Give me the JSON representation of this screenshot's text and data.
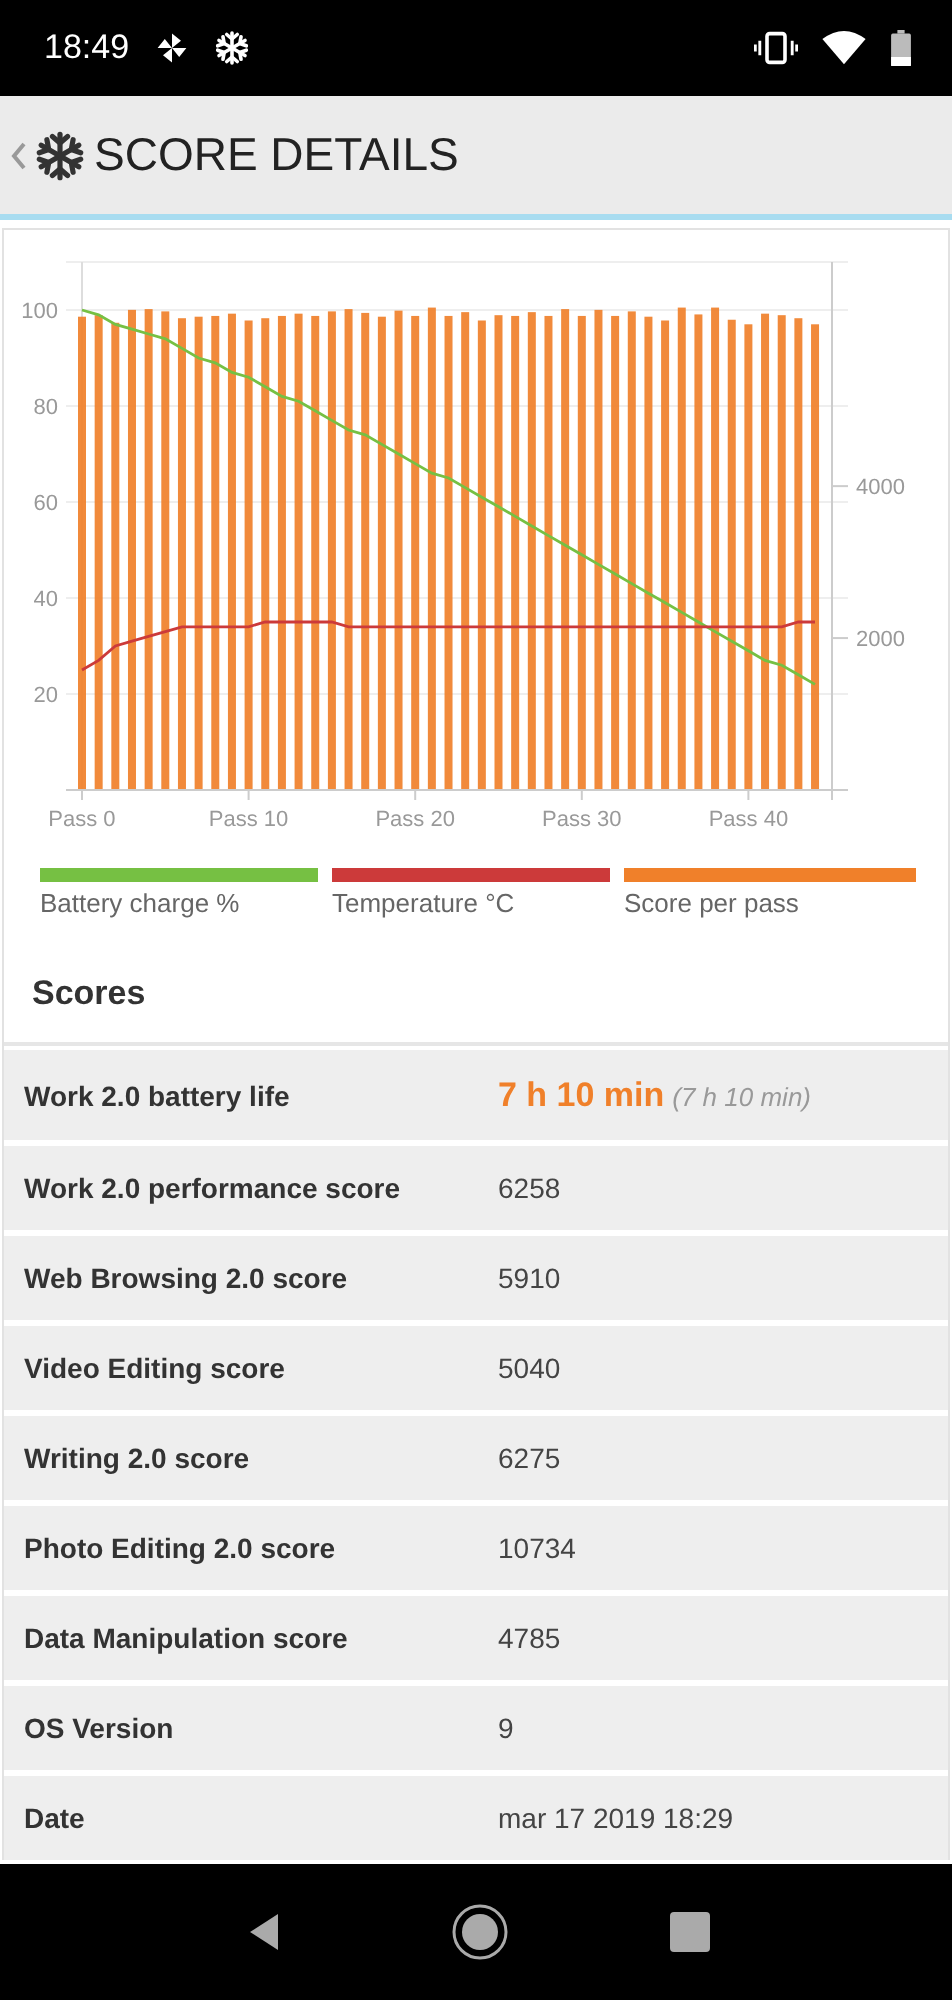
{
  "status_bar": {
    "time": "18:49"
  },
  "header": {
    "title": "SCORE DETAILS"
  },
  "chart_data": {
    "type": "bar",
    "categories": [
      "Pass 0",
      null,
      null,
      null,
      null,
      null,
      null,
      null,
      null,
      null,
      "Pass 10",
      null,
      null,
      null,
      null,
      null,
      null,
      null,
      null,
      null,
      "Pass 20",
      null,
      null,
      null,
      null,
      null,
      null,
      null,
      null,
      null,
      "Pass 30",
      null,
      null,
      null,
      null,
      null,
      null,
      null,
      null,
      null,
      "Pass 40",
      null,
      null,
      null,
      null
    ],
    "grid": true,
    "ylim": [
      0,
      110
    ],
    "yticks": [
      20,
      40,
      60,
      80,
      100
    ],
    "y2lim": [
      0,
      6950
    ],
    "y2ticks": [
      2000,
      4000
    ],
    "series": [
      {
        "name": "Battery charge %",
        "color": "#76c043",
        "type": "line",
        "values": [
          100,
          99,
          97,
          96,
          95,
          94,
          92,
          90,
          89,
          87,
          86,
          84,
          82,
          81,
          79,
          77,
          75,
          74,
          72,
          70,
          68,
          66,
          65,
          63,
          61,
          59,
          57,
          55,
          53,
          51,
          49,
          47,
          45,
          43,
          41,
          39,
          37,
          35,
          33,
          31,
          29,
          27,
          26,
          24,
          22
        ]
      },
      {
        "name": "Temperature °C",
        "color": "#cc3a3a",
        "type": "line",
        "values": [
          25,
          27,
          30,
          31,
          32,
          33,
          34,
          34,
          34,
          34,
          34,
          35,
          35,
          35,
          35,
          35,
          34,
          34,
          34,
          34,
          34,
          34,
          34,
          34,
          34,
          34,
          34,
          34,
          34,
          34,
          34,
          34,
          34,
          34,
          34,
          34,
          34,
          34,
          34,
          34,
          34,
          34,
          34,
          35,
          35
        ]
      },
      {
        "name": "Score per pass",
        "color": "#f0802a",
        "type": "bar",
        "axis": "y2",
        "values": [
          6230,
          6250,
          6150,
          6320,
          6330,
          6300,
          6210,
          6230,
          6240,
          6270,
          6180,
          6210,
          6240,
          6270,
          6240,
          6300,
          6330,
          6280,
          6230,
          6310,
          6240,
          6350,
          6240,
          6290,
          6180,
          6250,
          6240,
          6290,
          6240,
          6330,
          6240,
          6320,
          6240,
          6300,
          6230,
          6180,
          6350,
          6260,
          6350,
          6190,
          6130,
          6270,
          6250,
          6210,
          6130
        ]
      }
    ]
  },
  "scores": {
    "title": "Scores",
    "rows": [
      {
        "kind": "duration",
        "label": "Work 2.0 battery life",
        "value": "7 h 10 min",
        "note": "(7 h 10 min)"
      },
      {
        "kind": "plain",
        "label": "Work 2.0 performance score",
        "value": "6258"
      },
      {
        "kind": "plain",
        "label": "Web Browsing 2.0 score",
        "value": "5910"
      },
      {
        "kind": "plain",
        "label": "Video Editing score",
        "value": "5040"
      },
      {
        "kind": "plain",
        "label": "Writing 2.0 score",
        "value": "6275"
      },
      {
        "kind": "plain",
        "label": "Photo Editing 2.0 score",
        "value": "10734"
      },
      {
        "kind": "plain",
        "label": "Data Manipulation score",
        "value": "4785"
      },
      {
        "kind": "plain",
        "label": "OS Version",
        "value": "9"
      },
      {
        "kind": "plain",
        "label": "Date",
        "value": "mar 17 2019 18:29"
      }
    ]
  }
}
